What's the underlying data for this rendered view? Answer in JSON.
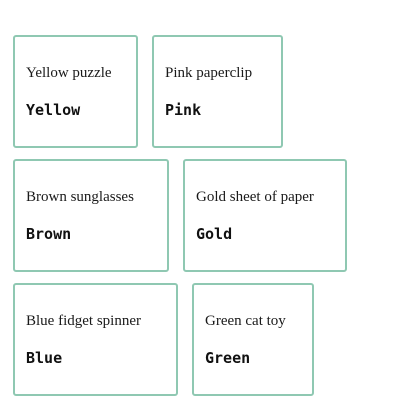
{
  "items": [
    {
      "name": "Yellow puzzle",
      "color": "Yellow"
    },
    {
      "name": "Pink paperclip",
      "color": "Pink"
    },
    {
      "name": "Brown sunglasses",
      "color": "Brown"
    },
    {
      "name": "Gold sheet of paper",
      "color": "Gold"
    },
    {
      "name": "Blue fidget spinner",
      "color": "Blue"
    },
    {
      "name": "Green cat toy",
      "color": "Green"
    }
  ],
  "colors": {
    "card_border": "#8fc8b2",
    "text": "#1a1a1a"
  }
}
